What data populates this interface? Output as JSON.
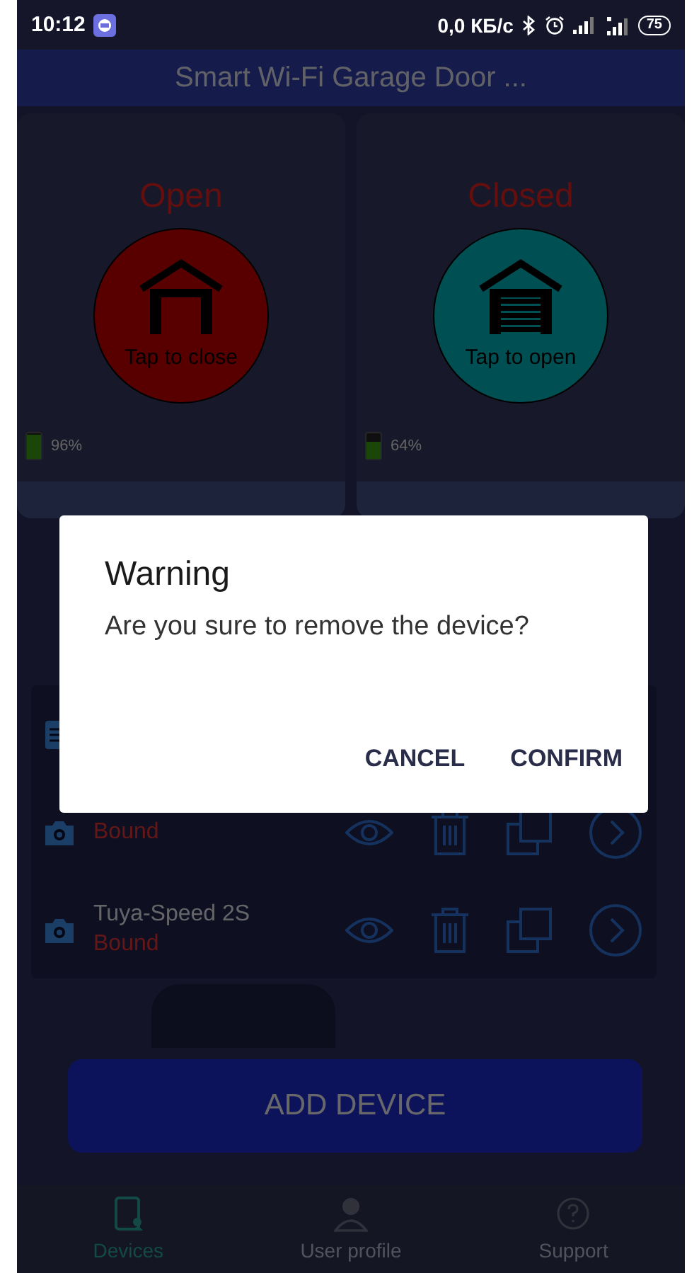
{
  "status_bar": {
    "time": "10:12",
    "speed": "0,0 КБ/с",
    "battery": "75"
  },
  "app_bar": {
    "title": "Smart Wi-Fi Garage Door ..."
  },
  "doors": [
    {
      "door_closed": false,
      "label": "Open",
      "hint": "Tap to close",
      "battery": {
        "level": 0.96,
        "reading": "96%"
      }
    },
    {
      "door_closed": true,
      "label": "Closed",
      "hint": "Tap to open",
      "battery": {
        "level": 0.64,
        "reading": "64%"
      }
    }
  ],
  "devices": [
    {
      "kind": "sensor"
    },
    {
      "kind": "camera",
      "status": "Bound"
    },
    {
      "kind": "camera",
      "name": "Tuya-Speed 2S",
      "status": "Bound"
    }
  ],
  "add_button": "ADD DEVICE",
  "nav": [
    {
      "kind": "devices",
      "label": "Devices",
      "selected": true
    },
    {
      "kind": "profile",
      "label": "User profile",
      "selected": false
    },
    {
      "kind": "support",
      "label": "Support",
      "selected": false
    }
  ],
  "dialog": {
    "title": "Warning",
    "message": "Are you sure to remove the device?",
    "buttons": [
      "CANCEL",
      "CONFIRM"
    ]
  }
}
